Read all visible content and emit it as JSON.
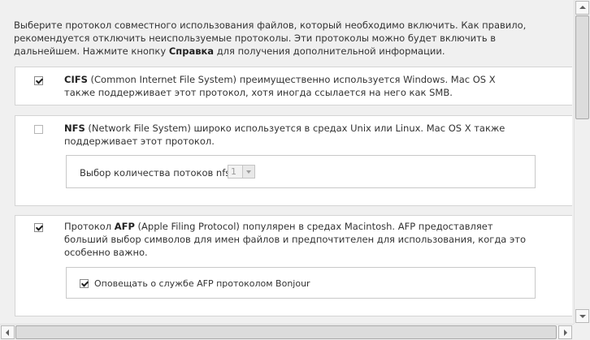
{
  "intro": {
    "line1": "Выберите протокол совместного использования файлов, который необходимо включить. Как правило,",
    "line2": "рекомендуется отключить неиспользуемые протоколы. Эти протоколы можно будет включить в",
    "line3_before": "дальнейшем. Нажмите кнопку ",
    "line3_bold": "Справка",
    "line3_after": " для получения дополнительной информации."
  },
  "cifs": {
    "checked": true,
    "name": "CIFS",
    "line1": " (Common Internet File System) преимущественно используется Windows. Mac OS X",
    "line2": "также поддерживает этот протокол, хотя иногда ссылается на него как SMB."
  },
  "nfs": {
    "checked": false,
    "name": "NFS",
    "line1": " (Network File System) широко используется в средах Unix или Linux. Mac OS X также",
    "line2": "поддерживает этот протокол.",
    "threads_label": "Выбор количества потоков nfs:",
    "threads_value": "1"
  },
  "afp": {
    "checked": true,
    "prefix": "Протокол ",
    "name": "AFP",
    "line1": " (Apple Filing Protocol) популярен в средах Macintosh. AFP предоставляет",
    "line2": "больший выбор символов для имен файлов и предпочтителен для использования, когда это",
    "line3": "особенно важно.",
    "bonjour_checked": true,
    "bonjour_label": "Оповещать о службе AFP протоколом Bonjour"
  },
  "icons": {
    "scroll_up": "arrow-up-icon",
    "scroll_down": "arrow-down-icon",
    "scroll_left": "arrow-left-icon",
    "scroll_right": "arrow-right-icon"
  }
}
